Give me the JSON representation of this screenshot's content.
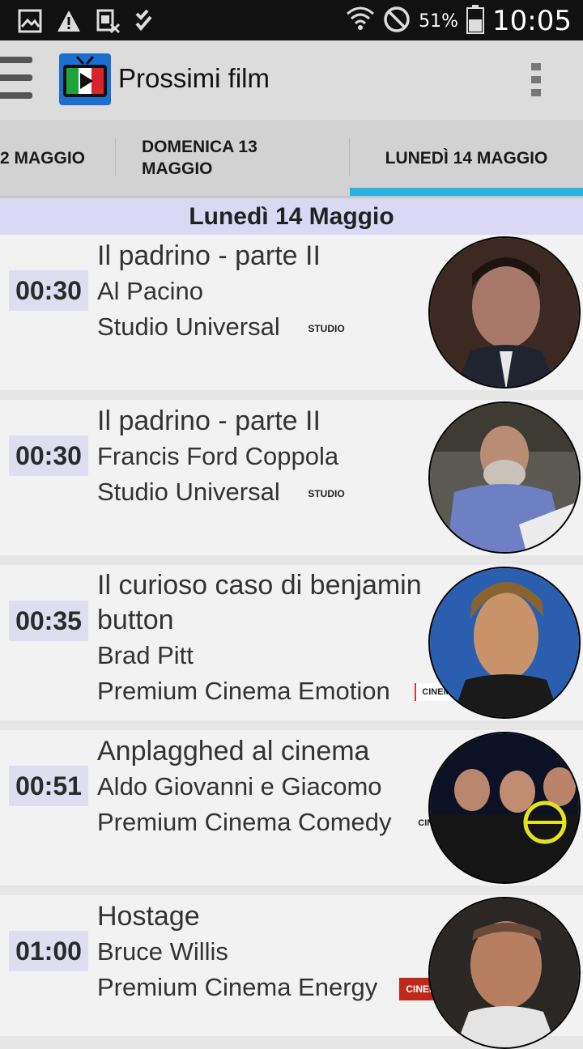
{
  "status_bar": {
    "battery_percent": "51%",
    "clock": "10:05"
  },
  "app_bar": {
    "title": "Prossimi film"
  },
  "tabs": [
    {
      "label": "2 MAGGIO"
    },
    {
      "label": "DOMENICA 13 MAGGIO"
    },
    {
      "label": "LUNEDÌ 14 MAGGIO"
    }
  ],
  "date_header": "Lunedì 14 Maggio",
  "listings": [
    {
      "time": "00:30",
      "title": "Il padrino - parte II",
      "person": "Al Pacino",
      "channel": "Studio Universal",
      "channel_logo": "STUDIO"
    },
    {
      "time": "00:30",
      "title": "Il padrino - parte II",
      "person": "Francis Ford Coppola",
      "channel": "Studio Universal",
      "channel_logo": "STUDIO"
    },
    {
      "time": "00:35",
      "title": "Il curioso caso di benjamin button",
      "person": "Brad Pitt",
      "channel": "Premium Cinema Emotion",
      "channel_logo": "CINEMA"
    },
    {
      "time": "00:51",
      "title": "Anplagghed al cinema",
      "person": "Aldo Giovanni e Giacomo",
      "channel": "Premium Cinema Comedy",
      "channel_logo": "CINEMA"
    },
    {
      "time": "01:00",
      "title": "Hostage",
      "person": "Bruce Willis",
      "channel": "Premium Cinema Energy",
      "channel_logo": "CINEMA"
    }
  ],
  "colors": {
    "accent": "#2ab1e0",
    "date_header_bg": "#d9d9f5",
    "status_bar_bg": "#111111"
  }
}
